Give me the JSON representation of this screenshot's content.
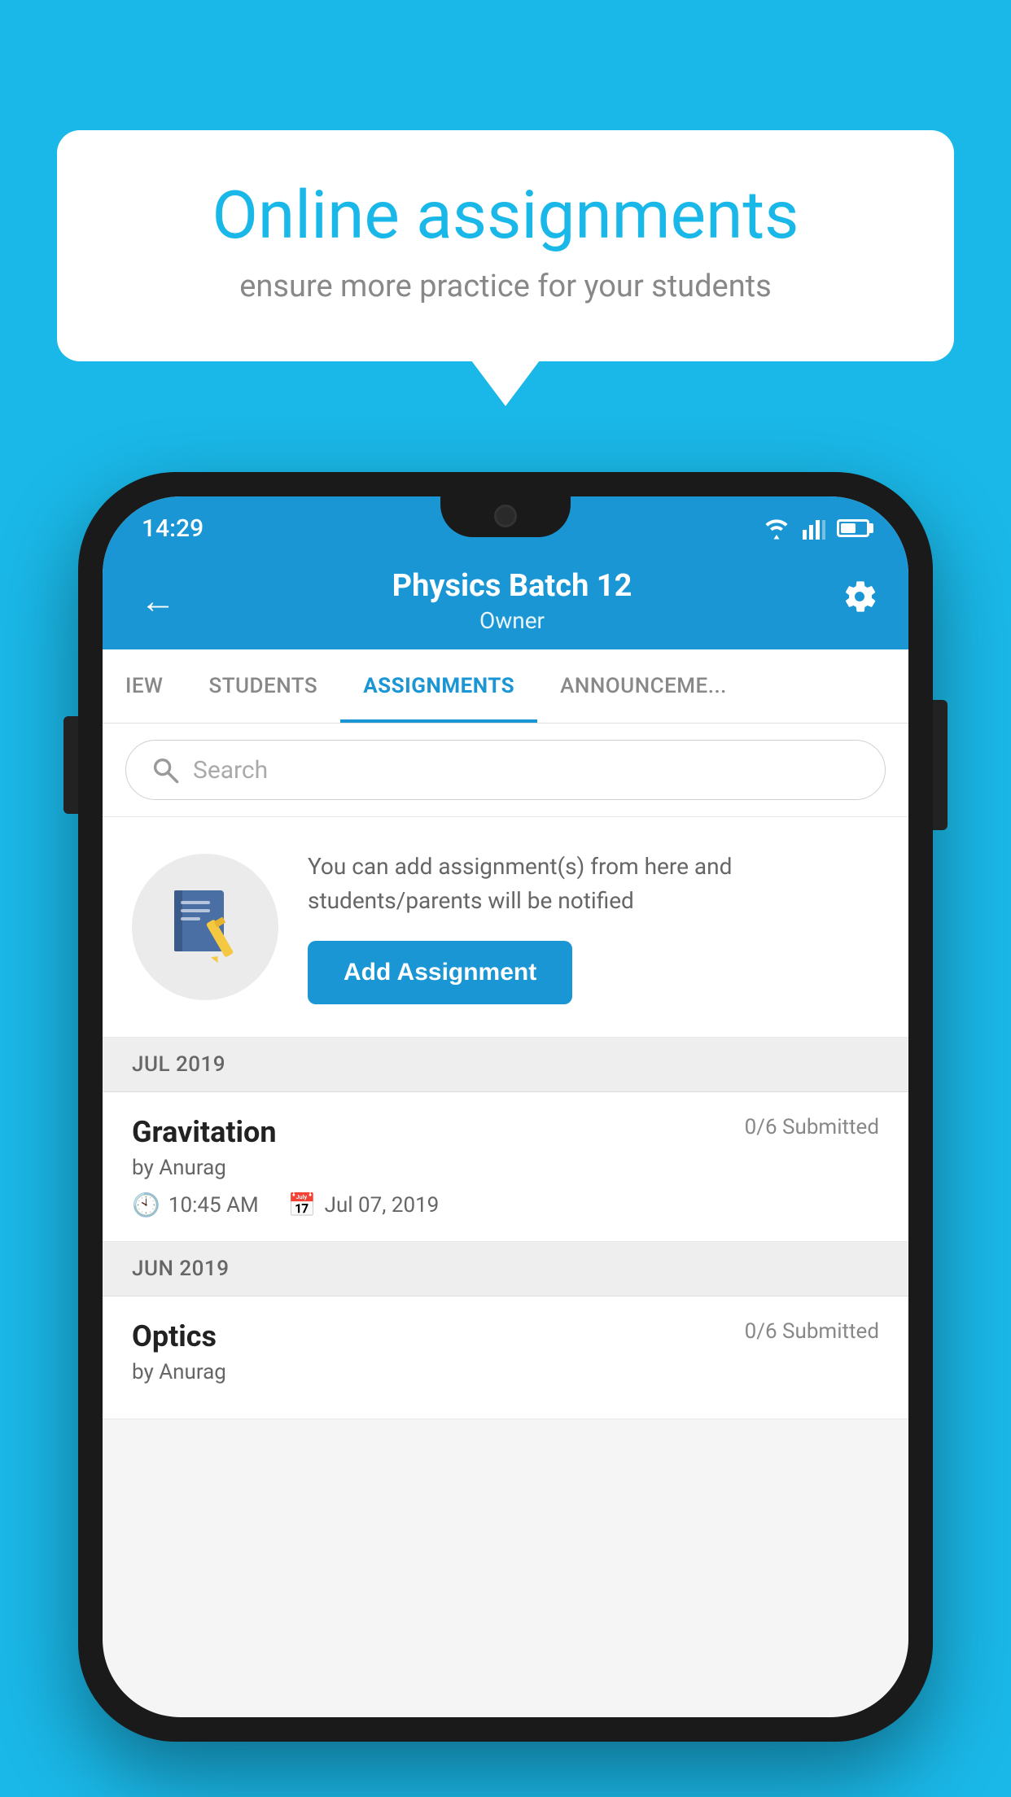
{
  "background_color": "#1ab8e8",
  "speech_bubble": {
    "title": "Online assignments",
    "subtitle": "ensure more practice for your students"
  },
  "status_bar": {
    "time": "14:29"
  },
  "app_bar": {
    "title": "Physics Batch 12",
    "subtitle": "Owner",
    "back_label": "←",
    "settings_label": "⚙"
  },
  "tabs": [
    {
      "label": "IEW",
      "active": false
    },
    {
      "label": "STUDENTS",
      "active": false
    },
    {
      "label": "ASSIGNMENTS",
      "active": true
    },
    {
      "label": "ANNOUNCEMENTS",
      "active": false
    }
  ],
  "search": {
    "placeholder": "Search"
  },
  "promo": {
    "description": "You can add assignment(s) from here and students/parents will be notified",
    "button_label": "Add Assignment"
  },
  "assignments": {
    "sections": [
      {
        "month": "JUL 2019",
        "items": [
          {
            "title": "Gravitation",
            "submitted": "0/6 Submitted",
            "author": "by Anurag",
            "time": "10:45 AM",
            "date": "Jul 07, 2019"
          }
        ]
      },
      {
        "month": "JUN 2019",
        "items": [
          {
            "title": "Optics",
            "submitted": "0/6 Submitted",
            "author": "by Anurag",
            "time": "",
            "date": ""
          }
        ]
      }
    ]
  }
}
